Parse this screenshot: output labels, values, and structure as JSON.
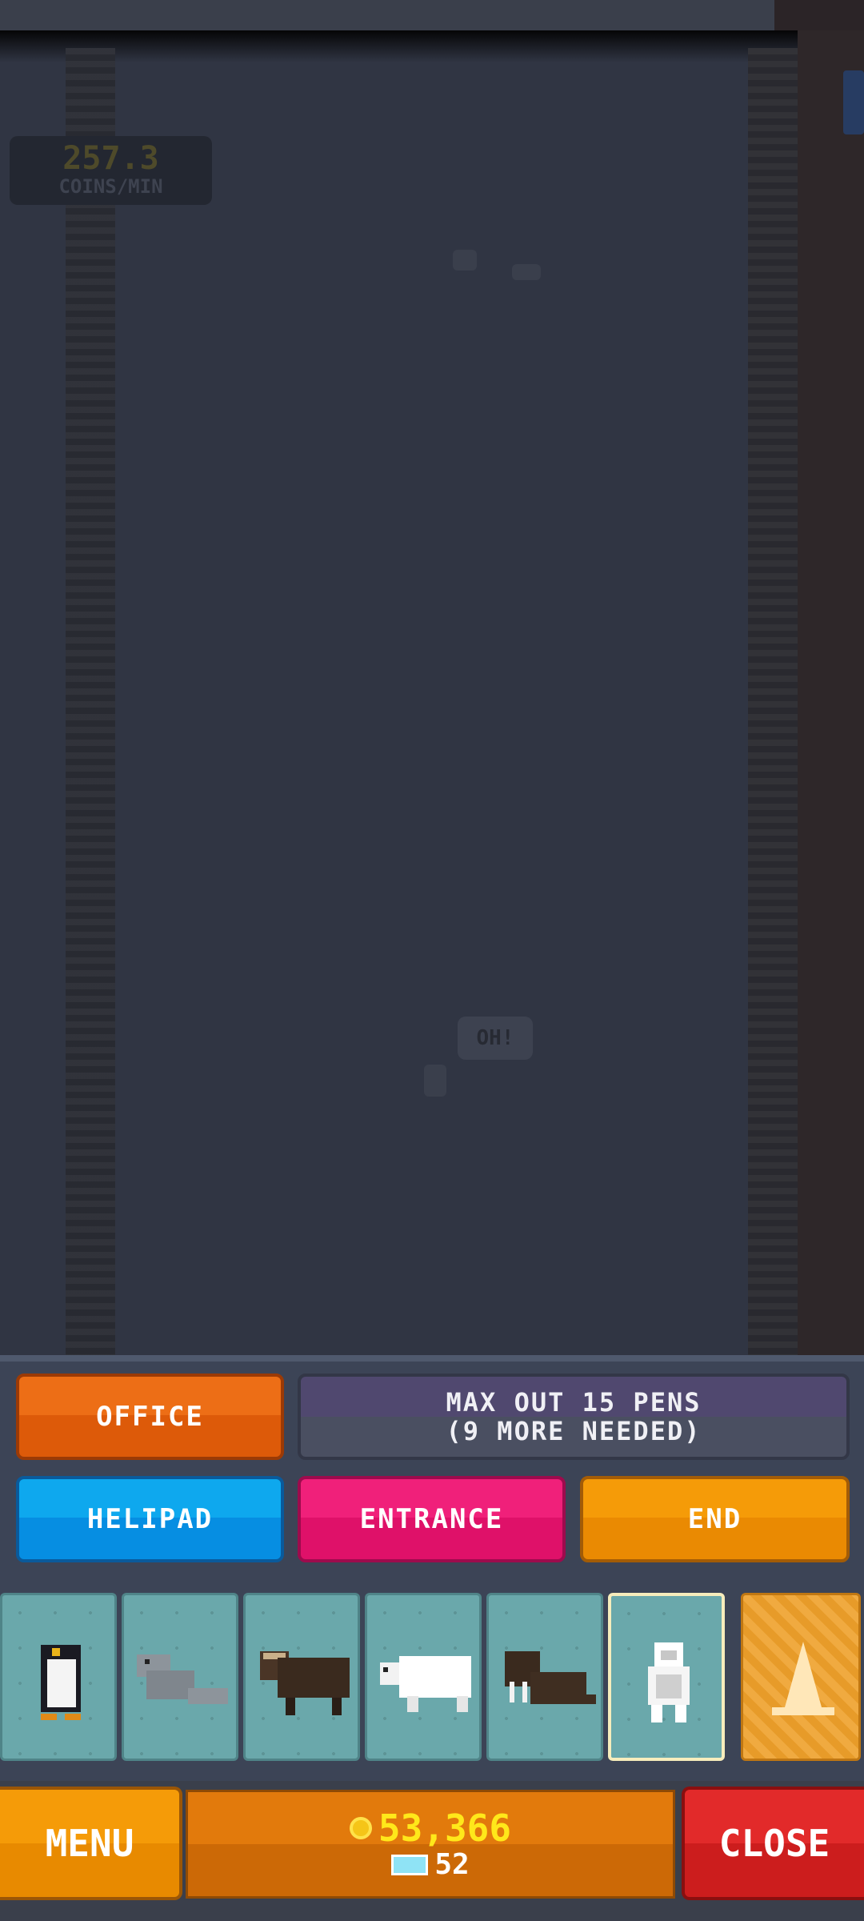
{
  "hud": {
    "rate_value": "257.3",
    "rate_label": "COINS/MIN"
  },
  "scene": {
    "speech": "OH!"
  },
  "buttons": {
    "office": "OFFICE",
    "goal_line1": "MAX OUT 15 PENS",
    "goal_line2": "(9 MORE NEEDED)",
    "helipad": "HELIPAD",
    "entrance": "ENTRANCE",
    "end": "END"
  },
  "tray": {
    "items": [
      {
        "icon": "penguin-icon"
      },
      {
        "icon": "seal-icon"
      },
      {
        "icon": "musk-ox-icon"
      },
      {
        "icon": "polar-bear-icon"
      },
      {
        "icon": "walrus-icon"
      },
      {
        "icon": "yeti-icon",
        "selected": true
      },
      {
        "icon": "traffic-cone-icon"
      }
    ]
  },
  "footer": {
    "menu": "MENU",
    "coins": "53,366",
    "gems": "52",
    "close": "CLOSE"
  },
  "colors": {
    "office": "#ed6e16",
    "helipad": "#0ea8ee",
    "entrance": "#f0207a",
    "end": "#f59b08",
    "close": "#e22a2a",
    "coins": "#ffe81a"
  }
}
